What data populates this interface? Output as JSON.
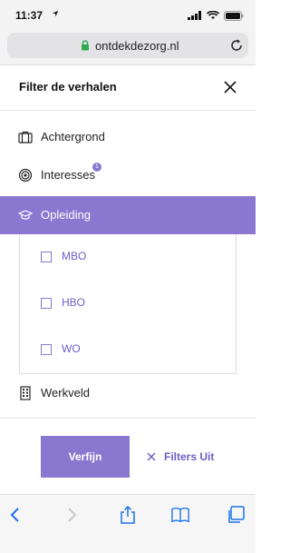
{
  "status_bar": {
    "time": "11:37"
  },
  "browser": {
    "host": "ontdekdezorg.nl"
  },
  "filter": {
    "title": "Filter de verhalen",
    "items": [
      {
        "label": "Achtergrond"
      },
      {
        "label": "Interesses",
        "badge": "1"
      },
      {
        "label": "Opleiding"
      },
      {
        "label": "Werkveld"
      }
    ],
    "opleiding_options": [
      {
        "label": "MBO"
      },
      {
        "label": "HBO"
      },
      {
        "label": "WO"
      }
    ]
  },
  "actions": {
    "apply_label": "Verfijn",
    "clear_label": "Filters Uit"
  },
  "colors": {
    "accent": "#8a78d0",
    "accent_text": "#6b5ec8"
  }
}
